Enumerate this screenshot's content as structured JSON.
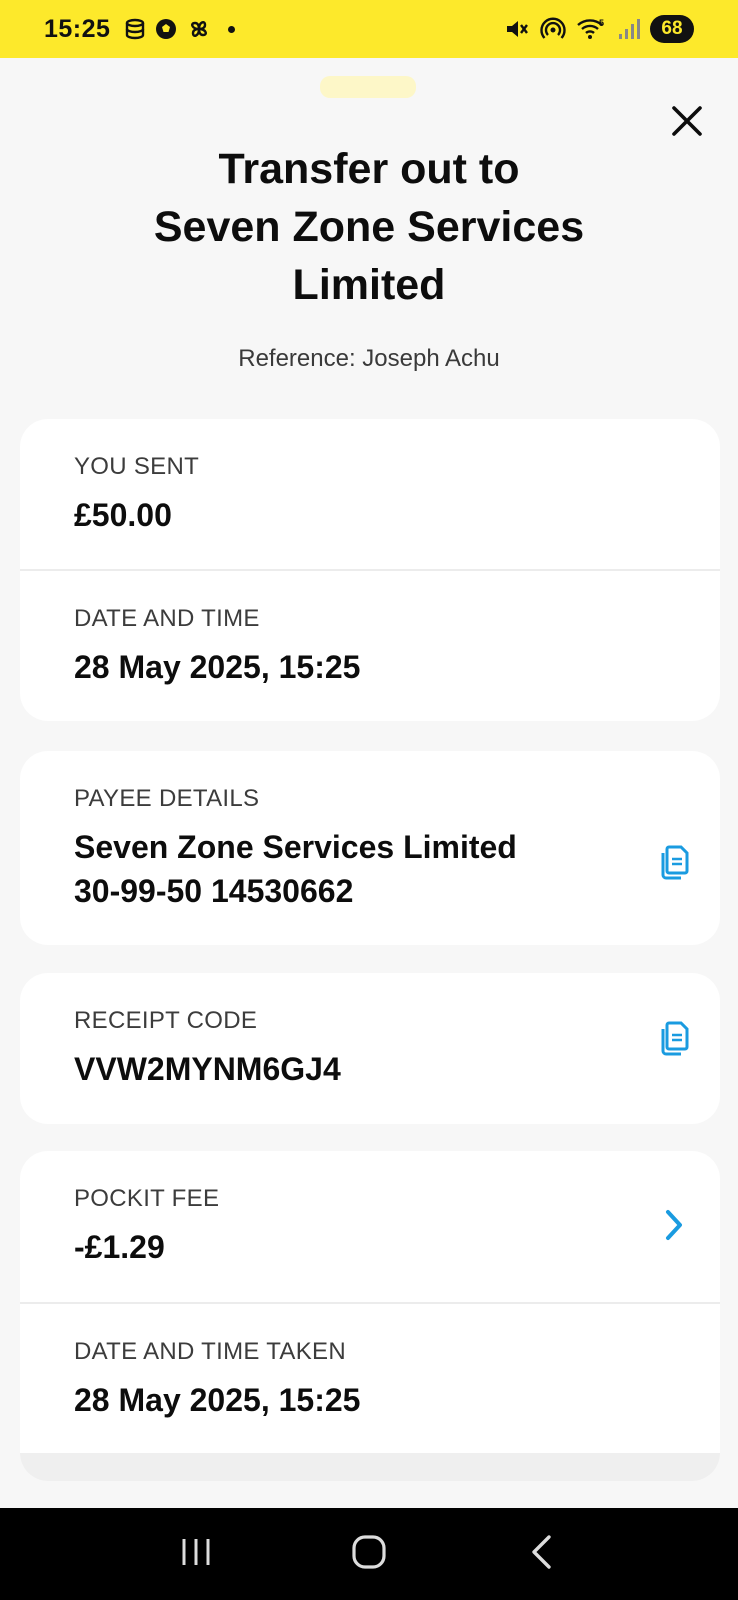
{
  "status_bar": {
    "time": "15:25",
    "battery": "68",
    "network": "5"
  },
  "header": {
    "title_line1": "Transfer out to",
    "title_line2": "Seven Zone Services",
    "title_line3": "Limited",
    "reference": "Reference: Joseph Achu"
  },
  "card1": {
    "sent_label": "YOU SENT",
    "sent_value": "£50.00",
    "date_label": "DATE AND TIME",
    "date_value": "28 May 2025, 15:25"
  },
  "card2": {
    "payee_label": "PAYEE DETAILS",
    "payee_name": "Seven Zone Services Limited",
    "payee_account": "30-99-50 14530662"
  },
  "card3": {
    "receipt_label": "RECEIPT CODE",
    "receipt_value": "VVW2MYNM6GJ4"
  },
  "card4": {
    "fee_label": "POCKIT FEE",
    "fee_value": "-£1.29",
    "taken_label": "DATE AND TIME TAKEN",
    "taken_value": "28 May 2025, 15:25"
  },
  "colors": {
    "brand_yellow": "#fde92b",
    "accent_blue": "#1a9be0"
  },
  "icons": [
    "close-icon",
    "copy-icon",
    "chevron-right-icon",
    "nav-recents-icon",
    "nav-home-icon",
    "nav-back-icon"
  ]
}
